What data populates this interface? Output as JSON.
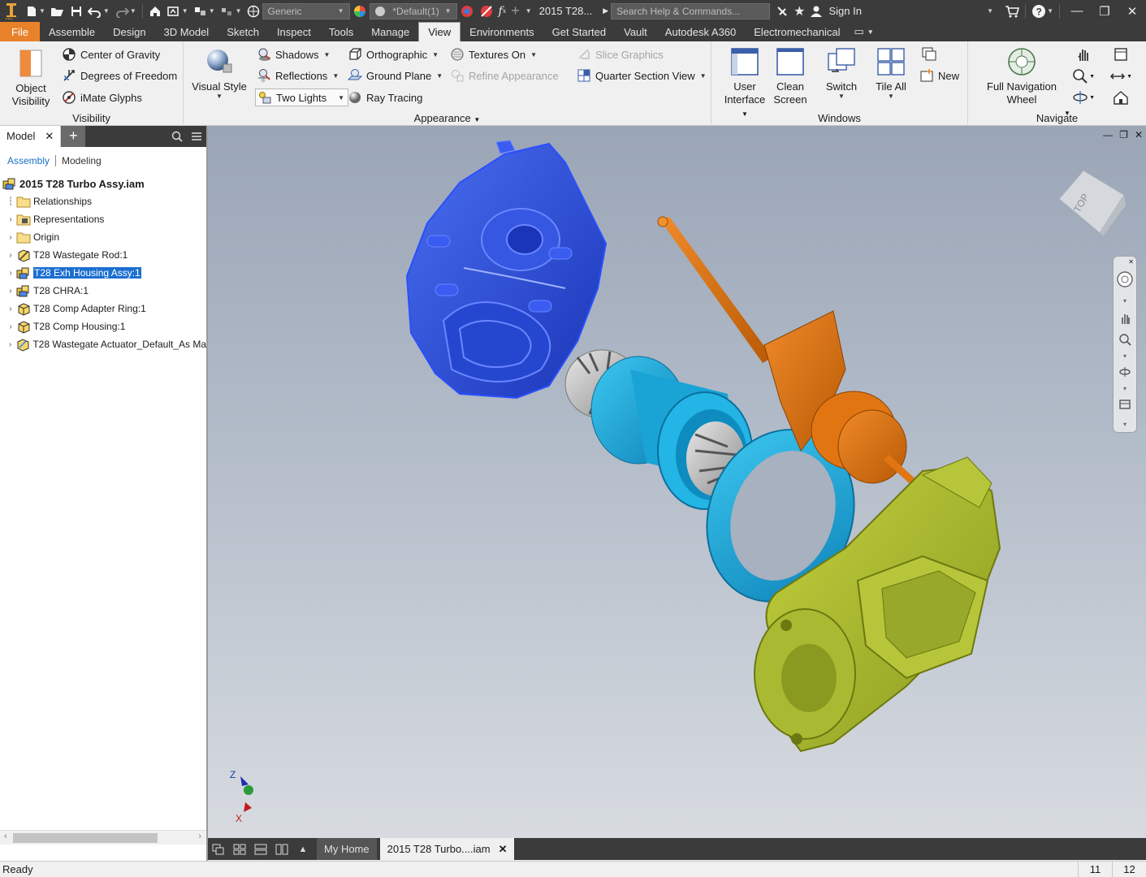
{
  "qat": {
    "appearance_combo": "Generic",
    "material_combo": "*Default(1)",
    "doc_title": "2015 T28...",
    "search_placeholder": "Search Help & Commands...",
    "sign_in": "Sign In"
  },
  "tabs": [
    "File",
    "Assemble",
    "Design",
    "3D Model",
    "Sketch",
    "Inspect",
    "Tools",
    "Manage",
    "View",
    "Environments",
    "Get Started",
    "Vault",
    "Autodesk A360",
    "Electromechanical"
  ],
  "active_tab": "View",
  "ribbon": {
    "visibility": {
      "title": "Visibility",
      "object_visibility": [
        "Object",
        "Visibility"
      ],
      "center_of_gravity": "Center of Gravity",
      "degrees_of_freedom": "Degrees of Freedom",
      "imate_glyphs": "iMate Glyphs"
    },
    "appearance": {
      "title": "Appearance",
      "visual_style": "Visual Style",
      "shadows": "Shadows",
      "reflections": "Reflections",
      "two_lights": "Two Lights",
      "orthographic": "Orthographic",
      "ground_plane": "Ground Plane",
      "ray_tracing": "Ray Tracing",
      "textures_on": "Textures On",
      "refine_appearance": "Refine Appearance",
      "slice_graphics": "Slice Graphics",
      "quarter_section_view": "Quarter Section View"
    },
    "windows": {
      "title": "Windows",
      "user_interface": [
        "User",
        "Interface"
      ],
      "clean_screen": [
        "Clean",
        "Screen"
      ],
      "switch": "Switch",
      "tile_all": "Tile All",
      "new": "New"
    },
    "navigate": {
      "title": "Navigate",
      "full_navigation_wheel": [
        "Full Navigation",
        "Wheel"
      ]
    }
  },
  "browser": {
    "tab_label": "Model",
    "mode_assembly": "Assembly",
    "mode_modeling": "Modeling",
    "root": "2015 T28 Turbo Assy.iam",
    "nodes": [
      "Relationships",
      "Representations",
      "Origin",
      "T28 Wastegate Rod:1",
      "T28 Exh Housing Assy:1",
      "T28 CHRA:1",
      "T28 Comp Adapter Ring:1",
      "T28 Comp Housing:1",
      "T28 Wastegate Actuator_Default_As Ma"
    ],
    "selected_node": "T28 Exh Housing Assy:1"
  },
  "viewcube": {
    "face": "TOP"
  },
  "triad": {
    "z": "Z",
    "x": "X"
  },
  "doc_tabs": {
    "home": "My Home",
    "active": "2015 T28 Turbo....iam"
  },
  "status": {
    "text": "Ready",
    "n1": "11",
    "n2": "12"
  },
  "colors": {
    "exhaust_housing": "#1f45d8",
    "chra": "#19a7d6",
    "adapter_ring": "#19a7d6",
    "actuator": "#d86c08",
    "comp_housing": "#a8b82e",
    "file_tab": "#e8822a",
    "selection": "#1c6fd1"
  }
}
